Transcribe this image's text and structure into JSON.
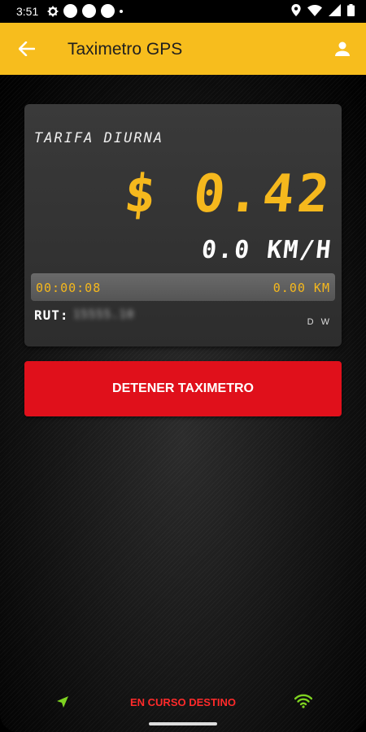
{
  "status_bar": {
    "time": "3:51"
  },
  "app_bar": {
    "title": "Taximetro GPS"
  },
  "meter": {
    "tariff_label": "TARIFA DIURNA",
    "fare": "$ 0.42",
    "speed": "0.0 KM/H",
    "timer": "00:00:08",
    "distance": "0.00 KM",
    "rut_label": "RUT:",
    "rut_value": "15555.10",
    "mode_indicator": "D W"
  },
  "actions": {
    "stop_label": "DETENER TAXIMETRO"
  },
  "footer": {
    "status_text": "EN CURSO DESTINO"
  },
  "colors": {
    "accent": "#f7bd1d",
    "fare_yellow": "#f5b81d",
    "stop_red": "#e0101b",
    "status_red": "#ff2a2a",
    "gps_green": "#7ed321"
  },
  "icons": {
    "back": "arrow-left-icon",
    "profile": "person-icon",
    "navigation": "navigation-arrow-icon",
    "signal": "wifi-icon"
  }
}
